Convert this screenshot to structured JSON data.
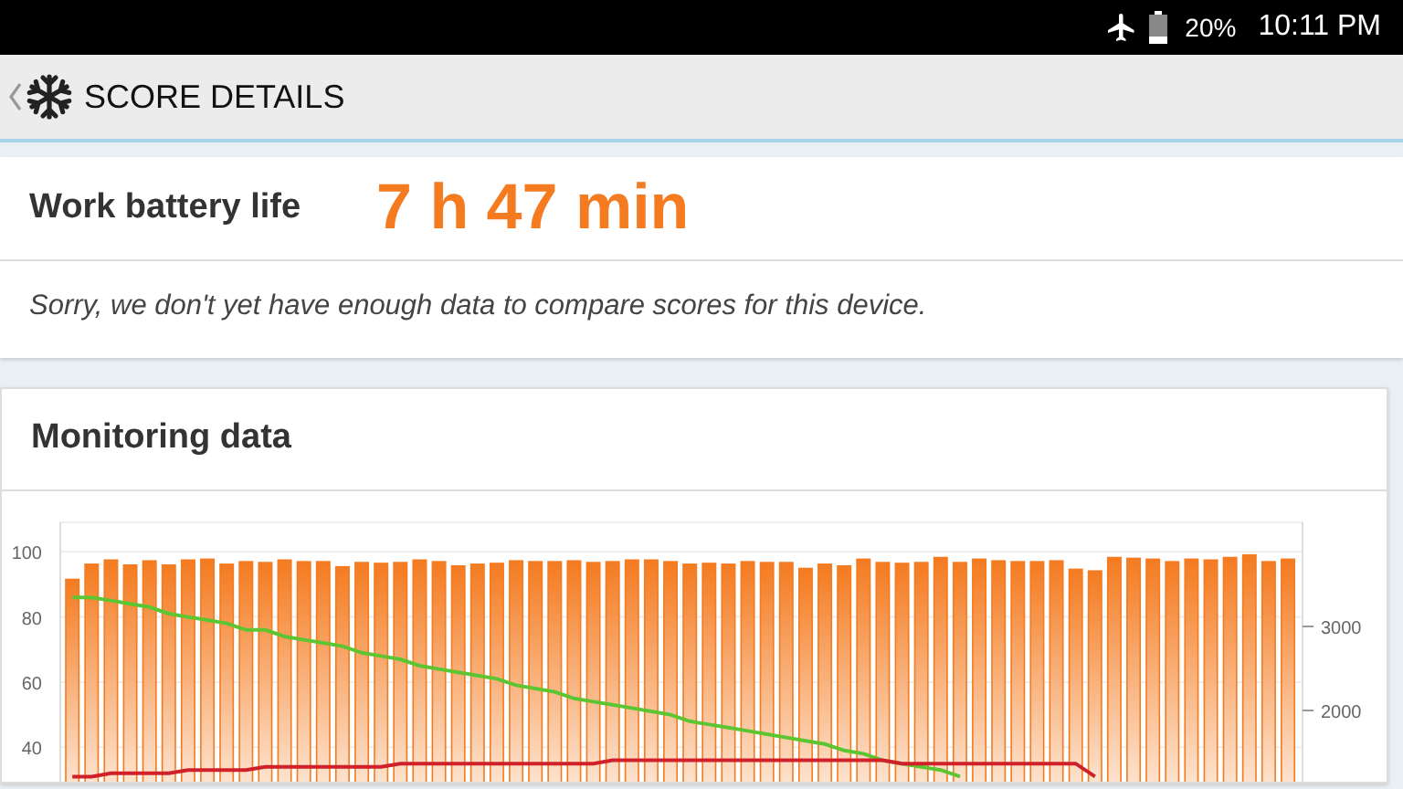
{
  "status_bar": {
    "battery_percent": "20%",
    "time": "10:11 PM"
  },
  "app_bar": {
    "title": "SCORE DETAILS"
  },
  "result_card": {
    "label": "Work battery life",
    "value": "7 h 47 min",
    "message": "Sorry, we don't yet have enough data to compare scores for this device."
  },
  "monitoring_card": {
    "title": "Monitoring data",
    "chart_data": {
      "type": "bar",
      "grid": true,
      "ylim": [
        30,
        109
      ],
      "yticks": [
        40,
        60,
        80,
        100
      ],
      "y2lim": [
        1174,
        4239
      ],
      "y2ticks": [
        2000,
        3000
      ],
      "series": [
        {
          "axis": "y2",
          "color": "#f47b20",
          "values": [
            3560,
            3740,
            3790,
            3730,
            3780,
            3730,
            3790,
            3800,
            3740,
            3770,
            3760,
            3790,
            3770,
            3770,
            3710,
            3760,
            3750,
            3760,
            3790,
            3770,
            3720,
            3740,
            3750,
            3780,
            3770,
            3770,
            3780,
            3760,
            3770,
            3790,
            3790,
            3770,
            3740,
            3750,
            3740,
            3770,
            3760,
            3760,
            3690,
            3740,
            3720,
            3800,
            3760,
            3750,
            3760,
            3820,
            3760,
            3800,
            3780,
            3770,
            3770,
            3780,
            3680,
            3660,
            3820,
            3810,
            3800,
            3770,
            3800,
            3790,
            3820,
            3850,
            3770,
            3800
          ]
        },
        {
          "type": "line",
          "color": "#5cc531",
          "values": [
            86,
            86,
            85,
            84,
            83,
            81,
            80,
            79,
            78,
            76,
            76,
            74,
            73,
            72,
            71,
            69,
            68,
            67,
            65,
            64,
            63,
            62,
            61,
            59,
            58,
            57,
            55,
            54,
            53,
            52,
            51,
            50,
            48,
            47,
            46,
            45,
            44,
            43,
            42,
            41,
            39,
            38,
            36,
            35,
            34,
            33,
            31,
            null,
            null,
            null,
            null,
            null,
            null,
            null,
            null,
            null,
            null,
            null,
            null,
            null,
            null,
            null,
            null,
            null
          ]
        },
        {
          "type": "line",
          "color": "#d0202a",
          "values": [
            31,
            31,
            32,
            32,
            32,
            32,
            33,
            33,
            33,
            33,
            34,
            34,
            34,
            34,
            34,
            34,
            34,
            35,
            35,
            35,
            35,
            35,
            35,
            35,
            35,
            35,
            35,
            35,
            36,
            36,
            36,
            36,
            36,
            36,
            36,
            36,
            36,
            36,
            36,
            36,
            36,
            36,
            36,
            35,
            35,
            35,
            35,
            35,
            35,
            35,
            35,
            35,
            35,
            31,
            null,
            null,
            null,
            null,
            null,
            null,
            null,
            null,
            null,
            null
          ]
        }
      ]
    }
  }
}
